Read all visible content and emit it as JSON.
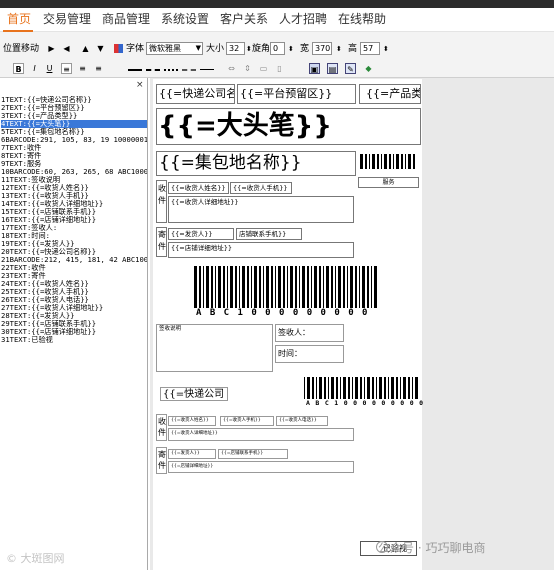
{
  "menu": [
    "首页",
    "交易管理",
    "商品管理",
    "系统设置",
    "客户关系",
    "人才招聘",
    "在线帮助"
  ],
  "toolbar": {
    "position_label": "位置移动",
    "font_label": "字体",
    "font_value": "微软雅黑",
    "size_label": "大小",
    "size_value": "32",
    "rotate_label": "旋角",
    "rotate_value": "0",
    "width_label": "宽",
    "width_value": "370",
    "height_label": "高",
    "height_value": "57",
    "bold": "B",
    "italic": "I",
    "underline": "U"
  },
  "left_panel": {
    "close": "×",
    "lines": [
      "1TEXT:{{=快递公司名称}}",
      "2TEXT:{{=平台预留区}}",
      "3TEXT:{{=产品类型}}",
      "4TEXT:{{=大头笔}}",
      "5TEXT:{{=集包地名称}}",
      "6BARCODE:291, 105, 83, 19  10000001",
      "7TEXT:收件",
      "8TEXT:寄件",
      "9TEXT:服务",
      "10BARCODE:60, 263, 265, 68  ABC1000000000",
      "11TEXT:签收说明",
      "12TEXT:{{=收货人姓名}}",
      "13TEXT:{{=收货人手机}}",
      "14TEXT:{{=收货人详细地址}}",
      "15TEXT:{{=店铺联系手机}}",
      "16TEXT:{{=店铺详细地址}}",
      "17TEXT:签收人:",
      "18TEXT:时间:",
      "19TEXT:{{=发货人}}",
      "20TEXT:{{=快递公司名称}}",
      "21BARCODE:212, 415, 181, 42  ABC1000000000",
      "22TEXT:收件",
      "23TEXT:寄件",
      "24TEXT:{{=收货人姓名}}",
      "25TEXT:{{=收货人手机}}",
      "26TEXT:{{=收货人电话}}",
      "27TEXT:{{=收货人详细地址}}",
      "28TEXT:{{=发货人}}",
      "29TEXT:{{=店铺联系手机}}",
      "30TEXT:{{=店铺详细地址}}",
      "31TEXT:已验视"
    ],
    "selected_index": 3,
    "watermark": "© 大斑图网"
  },
  "canvas": {
    "express_company": "{{=快递公司名",
    "platform_reserved": "{{=平台预留区}}",
    "product_type": "{{=产品类",
    "big_head_pen": "{{=大头笔}}",
    "hub_name": "{{=集包地名称}}",
    "service": "服务",
    "receive": "收件",
    "send": "寄件",
    "receiver_name": "{{=收货人姓名}}",
    "receiver_phone": "{{=收货人手机}}",
    "receiver_address": "{{=收货人详细地址}}",
    "shipper": "{{=发货人}}",
    "shop_phone": "店铺联系手机}}",
    "shop_address": "{{=店铺详细地址}}",
    "barcode_text": "A B C 1 0 0 0 0 0 0 0 0 0",
    "sign_note": "签收说明",
    "signer": "签收人：",
    "time": "时间：",
    "express_company_2": "{{=快递公司",
    "barcode_text_2": "A B C 1 0 0 0 0 0 0 0 0 0",
    "receiver_name_2": "{{=收货人姓名}}",
    "receiver_phone_2": "{{=收货人手机}}",
    "receiver_tel_2": "{{=收货人电话}}",
    "receiver_address_2": "{{=收货人详细地址}}",
    "shipper_2": "{{=发货人}}",
    "shop_phone_2": "{{=店铺联系手机}}",
    "shop_address_2": "{{=店铺详细地址}}",
    "inspected": "已验视",
    "watermark": "公众号 · 巧巧聊电商"
  },
  "colors": {
    "accent": "#e8731c",
    "selection": "#3a78d8"
  }
}
